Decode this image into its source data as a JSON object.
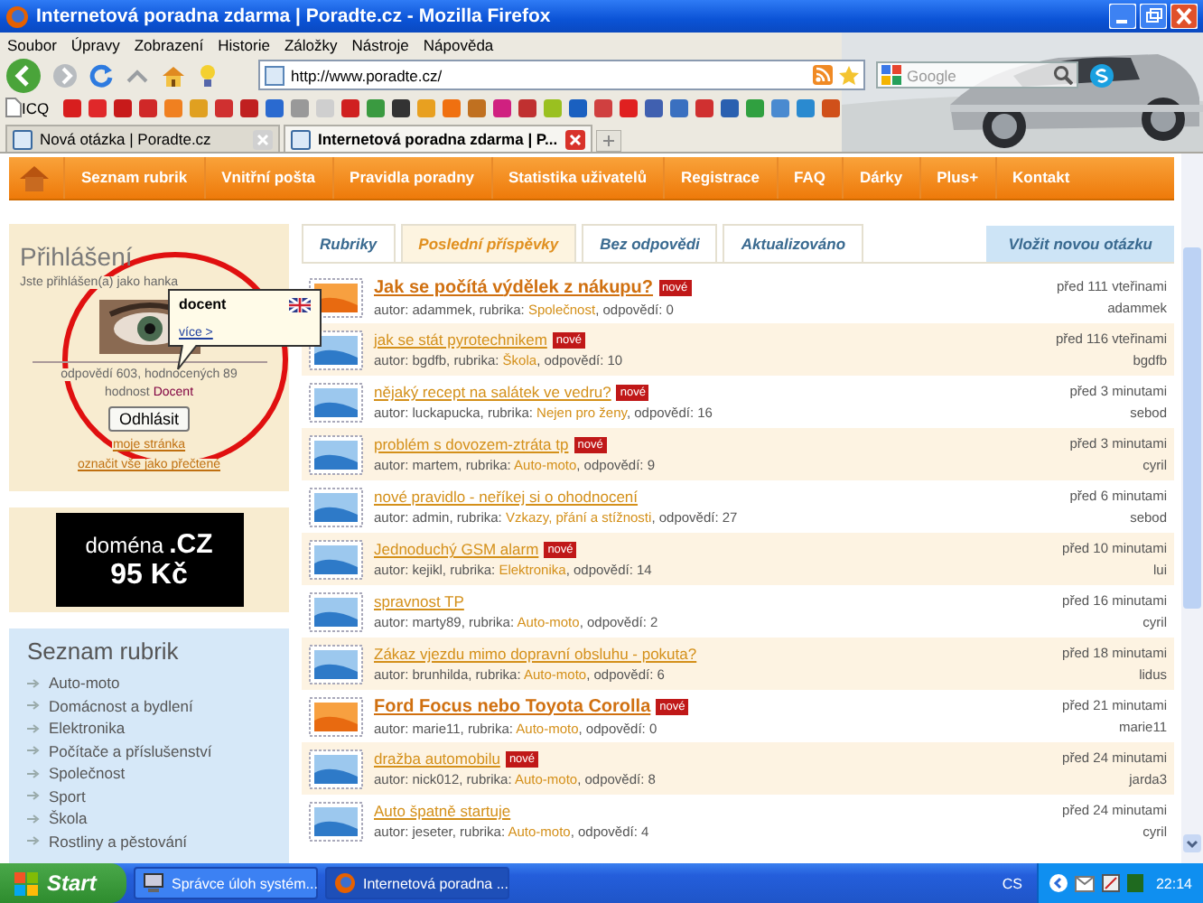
{
  "window": {
    "title": "Internetová poradna zdarma | Poradte.cz - Mozilla Firefox"
  },
  "menu": [
    "Soubor",
    "Úpravy",
    "Zobrazení",
    "Historie",
    "Záložky",
    "Nástroje",
    "Nápověda"
  ],
  "address_bar": {
    "value": "http://www.poradte.cz/"
  },
  "search": {
    "placeholder": "Google"
  },
  "bookmarks": [
    {
      "label": "ICQ"
    }
  ],
  "browser_tabs": [
    {
      "label": "Nová otázka | Poradte.cz",
      "selected": false
    },
    {
      "label": "Internetová poradna zdarma | P...",
      "selected": true
    }
  ],
  "site_nav": [
    "Seznam rubrik",
    "Vnitřní pošta",
    "Pravidla poradny",
    "Statistika uživatelů",
    "Registrace",
    "FAQ",
    "Dárky",
    "Plus+",
    "Kontakt"
  ],
  "login": {
    "title": "Přihlášení",
    "status": "Jste přihlášen(a) jako hanka",
    "stats": "odpovědí 603, hodnocených 89",
    "rank_label": "hodnost",
    "rank": "Docent",
    "logout": "Odhlásit",
    "links": [
      "moje stránka",
      "označit vše jako přečtené"
    ]
  },
  "tooltip": {
    "title": "docent",
    "link": "více >"
  },
  "ad": {
    "word": "doména",
    "tld": ".CZ",
    "price": "95 Kč"
  },
  "categories": {
    "title": "Seznam rubrik",
    "items": [
      "Auto-moto",
      "Domácnost a bydlení",
      "Elektronika",
      "Počítače a příslušenství",
      "Společnost",
      "Sport",
      "Škola",
      "Rostliny a pěstování"
    ]
  },
  "content_tabs": [
    {
      "label": "Rubriky",
      "selected": false
    },
    {
      "label": "Poslední příspěvky",
      "selected": true
    },
    {
      "label": "Bez odpovědi",
      "selected": false
    },
    {
      "label": "Aktualizováno",
      "selected": false
    }
  ],
  "new_question_button": "Vložit novou otázku",
  "posts": [
    {
      "title": "Jak se počítá výdělek z nákupu?",
      "featured": true,
      "badge": "nové",
      "meta_prefix": "autor: adammek, rubrika:",
      "category": "Společnost",
      "meta_suffix": ", odpovědí: 0",
      "time": "před 111 vteřinami",
      "last_user": "adammek"
    },
    {
      "title": "jak se stát pyrotechnikem",
      "featured": false,
      "badge": "nové",
      "meta_prefix": "autor: bgdfb, rubrika:",
      "category": "Škola",
      "meta_suffix": ", odpovědí: 10",
      "time": "před 116 vteřinami",
      "last_user": "bgdfb"
    },
    {
      "title": "nějaký recept na salátek ve vedru?",
      "featured": false,
      "badge": "nové",
      "meta_prefix": "autor: luckapucka, rubrika:",
      "category": "Nejen pro ženy",
      "meta_suffix": ", odpovědí: 16",
      "time": "před 3 minutami",
      "last_user": "sebod"
    },
    {
      "title": "problém s dovozem-ztráta tp",
      "featured": false,
      "badge": "nové",
      "meta_prefix": "autor: martem, rubrika:",
      "category": "Auto-moto",
      "meta_suffix": ", odpovědí: 9",
      "time": "před 3 minutami",
      "last_user": "cyril"
    },
    {
      "title": "nové pravidlo - neříkej si o ohodnocení",
      "featured": false,
      "meta_prefix": "autor: admin, rubrika:",
      "category": "Vzkazy, přání a stížnosti",
      "meta_suffix": ", odpovědí: 27",
      "time": "před 6 minutami",
      "last_user": "sebod"
    },
    {
      "title": "Jednoduchý GSM alarm",
      "featured": false,
      "badge": "nové",
      "meta_prefix": "autor: kejikl, rubrika:",
      "category": "Elektronika",
      "meta_suffix": ", odpovědí: 14",
      "time": "před 10 minutami",
      "last_user": "lui"
    },
    {
      "title": "spravnost TP",
      "featured": false,
      "meta_prefix": "autor: marty89, rubrika:",
      "category": "Auto-moto",
      "meta_suffix": ", odpovědí: 2",
      "time": "před 16 minutami",
      "last_user": "cyril"
    },
    {
      "title": "Zákaz vjezdu mimo dopravní obsluhu - pokuta?",
      "featured": false,
      "meta_prefix": "autor: brunhilda, rubrika:",
      "category": "Auto-moto",
      "meta_suffix": ", odpovědí: 6",
      "time": "před 18 minutami",
      "last_user": "lidus"
    },
    {
      "title": "Ford Focus nebo Toyota Corolla",
      "featured": true,
      "badge": "nové",
      "meta_prefix": "autor: marie11, rubrika:",
      "category": "Auto-moto",
      "meta_suffix": ", odpovědí: 0",
      "time": "před 21 minutami",
      "last_user": "marie11"
    },
    {
      "title": "dražba automobilu",
      "featured": false,
      "badge": "nové",
      "meta_prefix": "autor: nick012, rubrika:",
      "category": "Auto-moto",
      "meta_suffix": ", odpovědí: 8",
      "time": "před 24 minutami",
      "last_user": "jarda3"
    },
    {
      "title": "Auto špatně startuje",
      "featured": false,
      "meta_prefix": "autor: jeseter, rubrika:",
      "category": "Auto-moto",
      "meta_suffix": ", odpovědí: 4",
      "time": "před 24 minutami",
      "last_user": "cyril"
    }
  ],
  "taskbar": {
    "start": "Start",
    "tasks": [
      {
        "label": "Správce úloh systém...",
        "selected": false
      },
      {
        "label": "Internetová poradna ...",
        "selected": true
      }
    ],
    "language": "CS",
    "clock": "22:14"
  }
}
